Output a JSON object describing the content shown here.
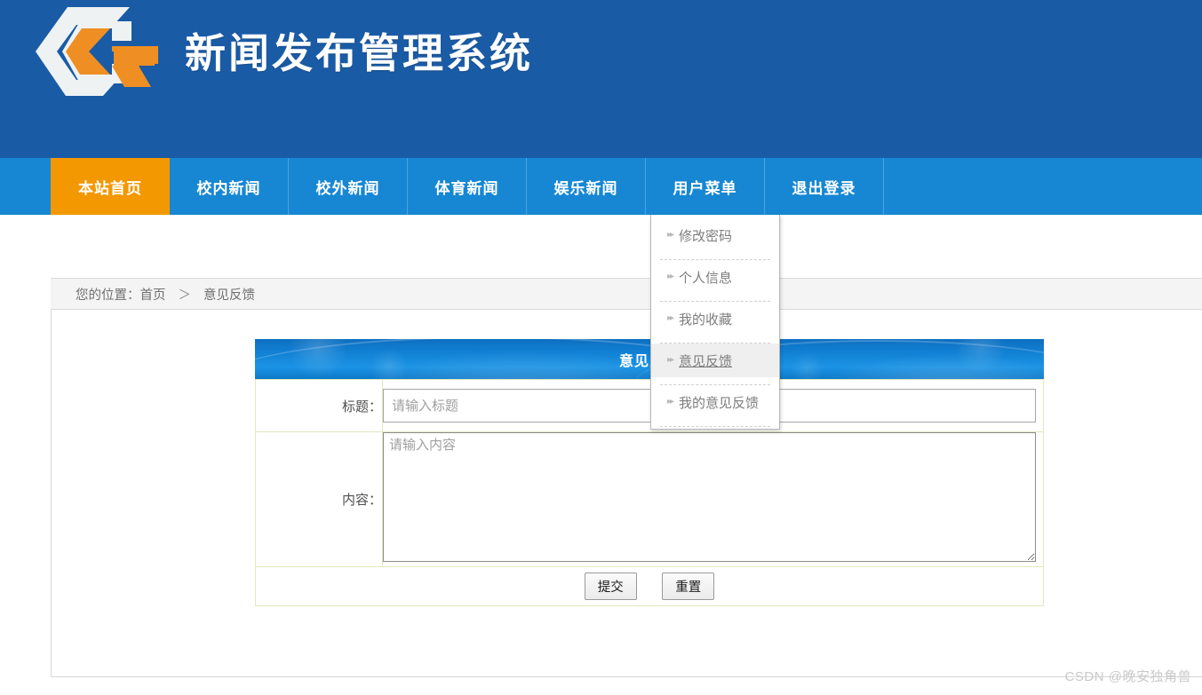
{
  "header": {
    "site_title": "新闻发布管理系统",
    "logo_name": "company-logo",
    "bg_color": "#1a5ba6"
  },
  "nav": {
    "bg_color": "#1787d4",
    "active_color": "#f39800",
    "items": [
      {
        "label": "本站首页",
        "active": true
      },
      {
        "label": "校内新闻",
        "active": false
      },
      {
        "label": "校外新闻",
        "active": false
      },
      {
        "label": "体育新闻",
        "active": false
      },
      {
        "label": "娱乐新闻",
        "active": false
      },
      {
        "label": "用户菜单",
        "active": false
      },
      {
        "label": "退出登录",
        "active": false
      }
    ]
  },
  "dropdown": {
    "parent": "用户菜单",
    "arrow_glyph": "▸▸",
    "items": [
      {
        "label": "修改密码",
        "hovered": false
      },
      {
        "label": "个人信息",
        "hovered": false
      },
      {
        "label": "我的收藏",
        "hovered": false
      },
      {
        "label": "意见反馈",
        "hovered": true
      },
      {
        "label": "我的意见反馈",
        "hovered": false
      }
    ]
  },
  "breadcrumb": {
    "prefix": "您的位置：",
    "home": "首页",
    "caret": "＞",
    "current": "意见反馈"
  },
  "panel": {
    "title": "意见反馈"
  },
  "form": {
    "title_label": "标题：",
    "title_value": "",
    "title_placeholder": "请输入标题",
    "content_label": "内容：",
    "content_value": "",
    "content_placeholder": "请输入内容",
    "submit_label": "提交",
    "reset_label": "重置"
  },
  "watermark": {
    "text": "CSDN @晚安独角兽"
  }
}
